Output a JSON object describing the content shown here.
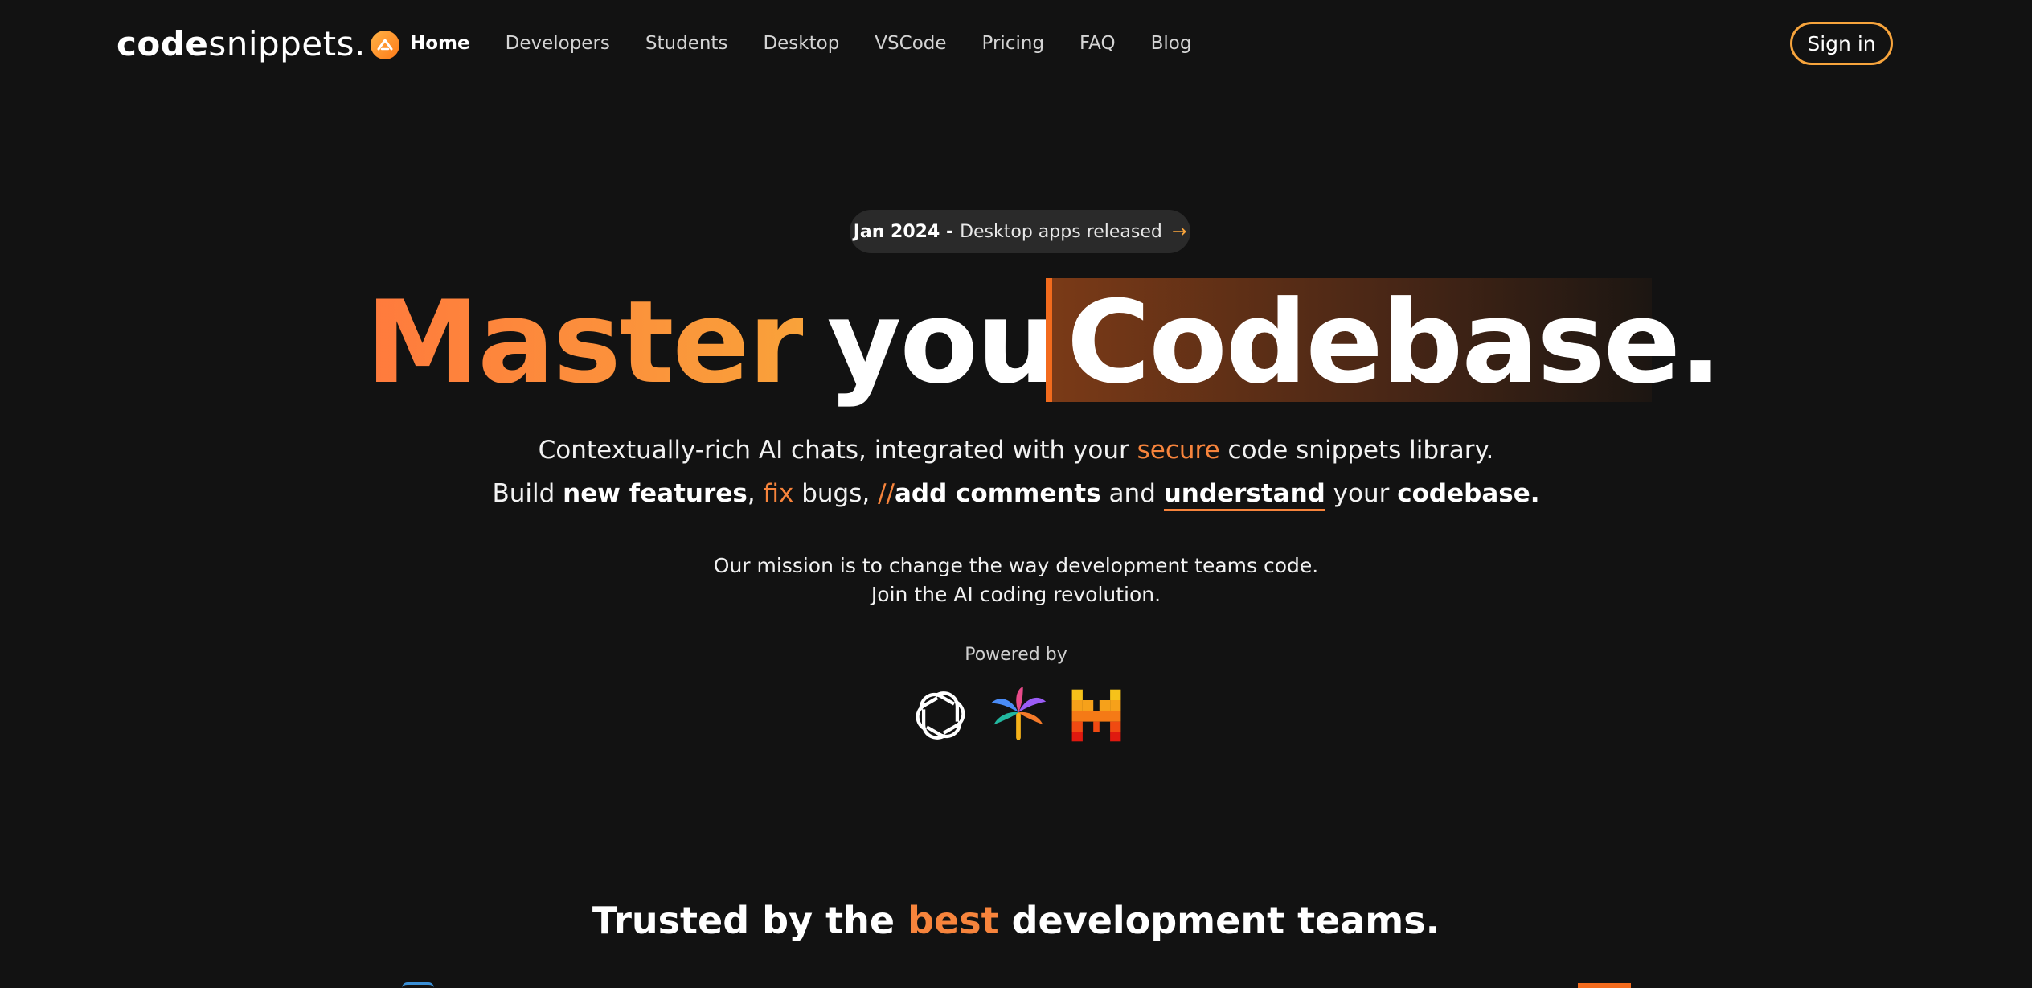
{
  "nav": {
    "logo": {
      "bold": "code",
      "thin": "snippets.",
      "badge_icon": "upward-chevron-icon"
    },
    "links": [
      {
        "label": "Home",
        "active": true
      },
      {
        "label": "Developers"
      },
      {
        "label": "Students"
      },
      {
        "label": "Desktop"
      },
      {
        "label": "VSCode"
      },
      {
        "label": "Pricing"
      },
      {
        "label": "FAQ"
      },
      {
        "label": "Blog"
      }
    ],
    "signin_label": "Sign in"
  },
  "announcement": {
    "date": "Jan 2024 -",
    "text": "Desktop apps released",
    "arrow": "→"
  },
  "headline": {
    "word1": "Master",
    "word2": "your",
    "word3": "Codebase."
  },
  "subtitle1": {
    "before": "Contextually-rich AI chats, integrated with your ",
    "highlight": "secure",
    "after": " code snippets library."
  },
  "subtitle2": {
    "p1": "Build ",
    "b1": "new features",
    "p2": ", ",
    "o1": "fix",
    "p3": " bugs, ",
    "o2": "//",
    "b2": "add comments",
    "p4": " and ",
    "u1": "understand",
    "p5": " your ",
    "b3": "codebase."
  },
  "mission": {
    "line1": "Our mission is to change the way development teams code.",
    "line2": "Join the AI coding revolution."
  },
  "powered_by": {
    "label": "Powered by",
    "providers": [
      "openai-logo-icon",
      "pinwheel-logo-icon",
      "mistral-logo-icon"
    ]
  },
  "trusted": {
    "before": "Trusted by the ",
    "highlight": "best",
    "after": " development teams."
  },
  "colors": {
    "background": "#121212",
    "accent_orange": "#f7843c",
    "accent_amber": "#f7a43c"
  }
}
